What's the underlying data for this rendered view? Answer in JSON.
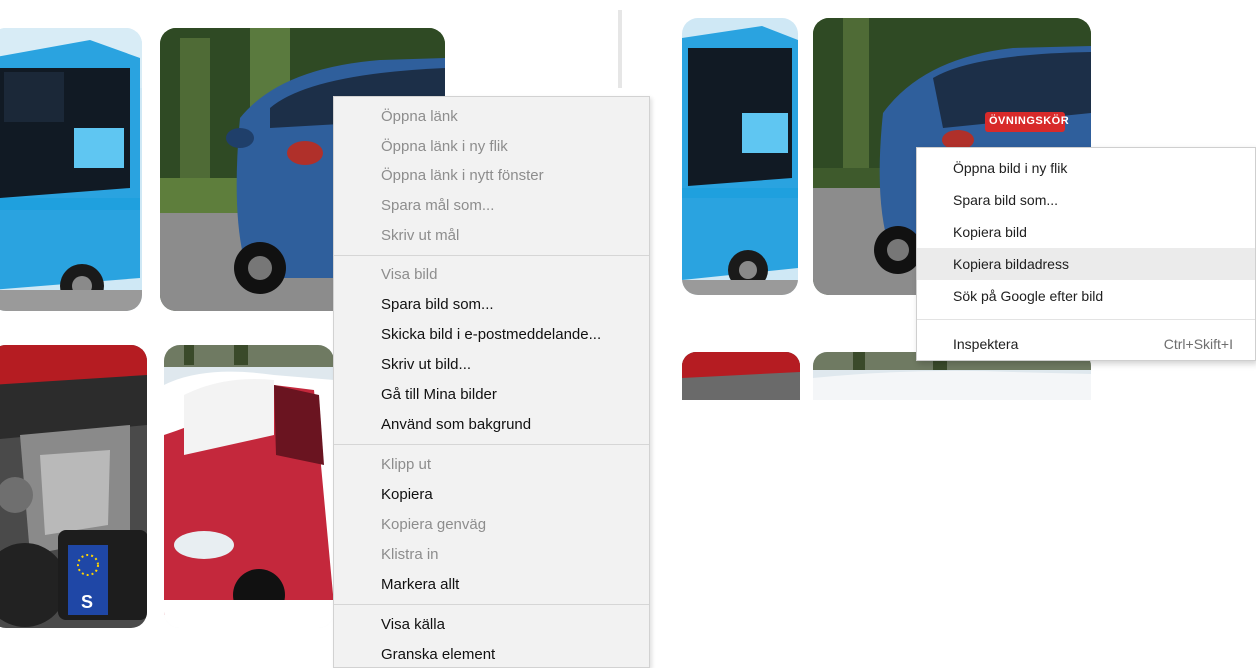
{
  "ie_menu": {
    "items": [
      {
        "label": "Öppna länk",
        "enabled": false
      },
      {
        "label": "Öppna länk i ny flik",
        "enabled": false
      },
      {
        "label": "Öppna länk i nytt fönster",
        "enabled": false
      },
      {
        "label": "Spara mål som...",
        "enabled": false
      },
      {
        "label": "Skriv ut mål",
        "enabled": false
      },
      {
        "label": "Visa bild",
        "enabled": false
      },
      {
        "label": "Spara bild som...",
        "enabled": true
      },
      {
        "label": "Skicka bild i e-postmeddelande...",
        "enabled": true
      },
      {
        "label": "Skriv ut bild...",
        "enabled": true
      },
      {
        "label": "Gå till Mina bilder",
        "enabled": true
      },
      {
        "label": "Använd som bakgrund",
        "enabled": true
      },
      {
        "label": "Klipp ut",
        "enabled": false
      },
      {
        "label": "Kopiera",
        "enabled": true
      },
      {
        "label": "Kopiera genväg",
        "enabled": false
      },
      {
        "label": "Klistra in",
        "enabled": false
      },
      {
        "label": "Markera allt",
        "enabled": true
      },
      {
        "label": "Visa källa",
        "enabled": true
      },
      {
        "label": "Granska element",
        "enabled": true
      }
    ]
  },
  "chrome_menu": {
    "items": [
      {
        "label": "Öppna bild i ny flik",
        "shortcut": ""
      },
      {
        "label": "Spara bild som...",
        "shortcut": ""
      },
      {
        "label": "Kopiera bild",
        "shortcut": ""
      },
      {
        "label": "Kopiera bildadress",
        "shortcut": "",
        "highlighted": true
      },
      {
        "label": "Sök på Google efter bild",
        "shortcut": ""
      },
      {
        "label": "Inspektera",
        "shortcut": "Ctrl+Skift+I"
      }
    ]
  },
  "images": {
    "rear_sign": "ÖVNINGSKÖR",
    "plate_letter": "S"
  },
  "colors": {
    "bus_blue": "#3aaee6",
    "car_blue": "#2f5f9c",
    "car_red": "#c4283c",
    "menu_ie_bg": "#f2f2f2",
    "menu_cr_hover": "#ebebeb"
  }
}
